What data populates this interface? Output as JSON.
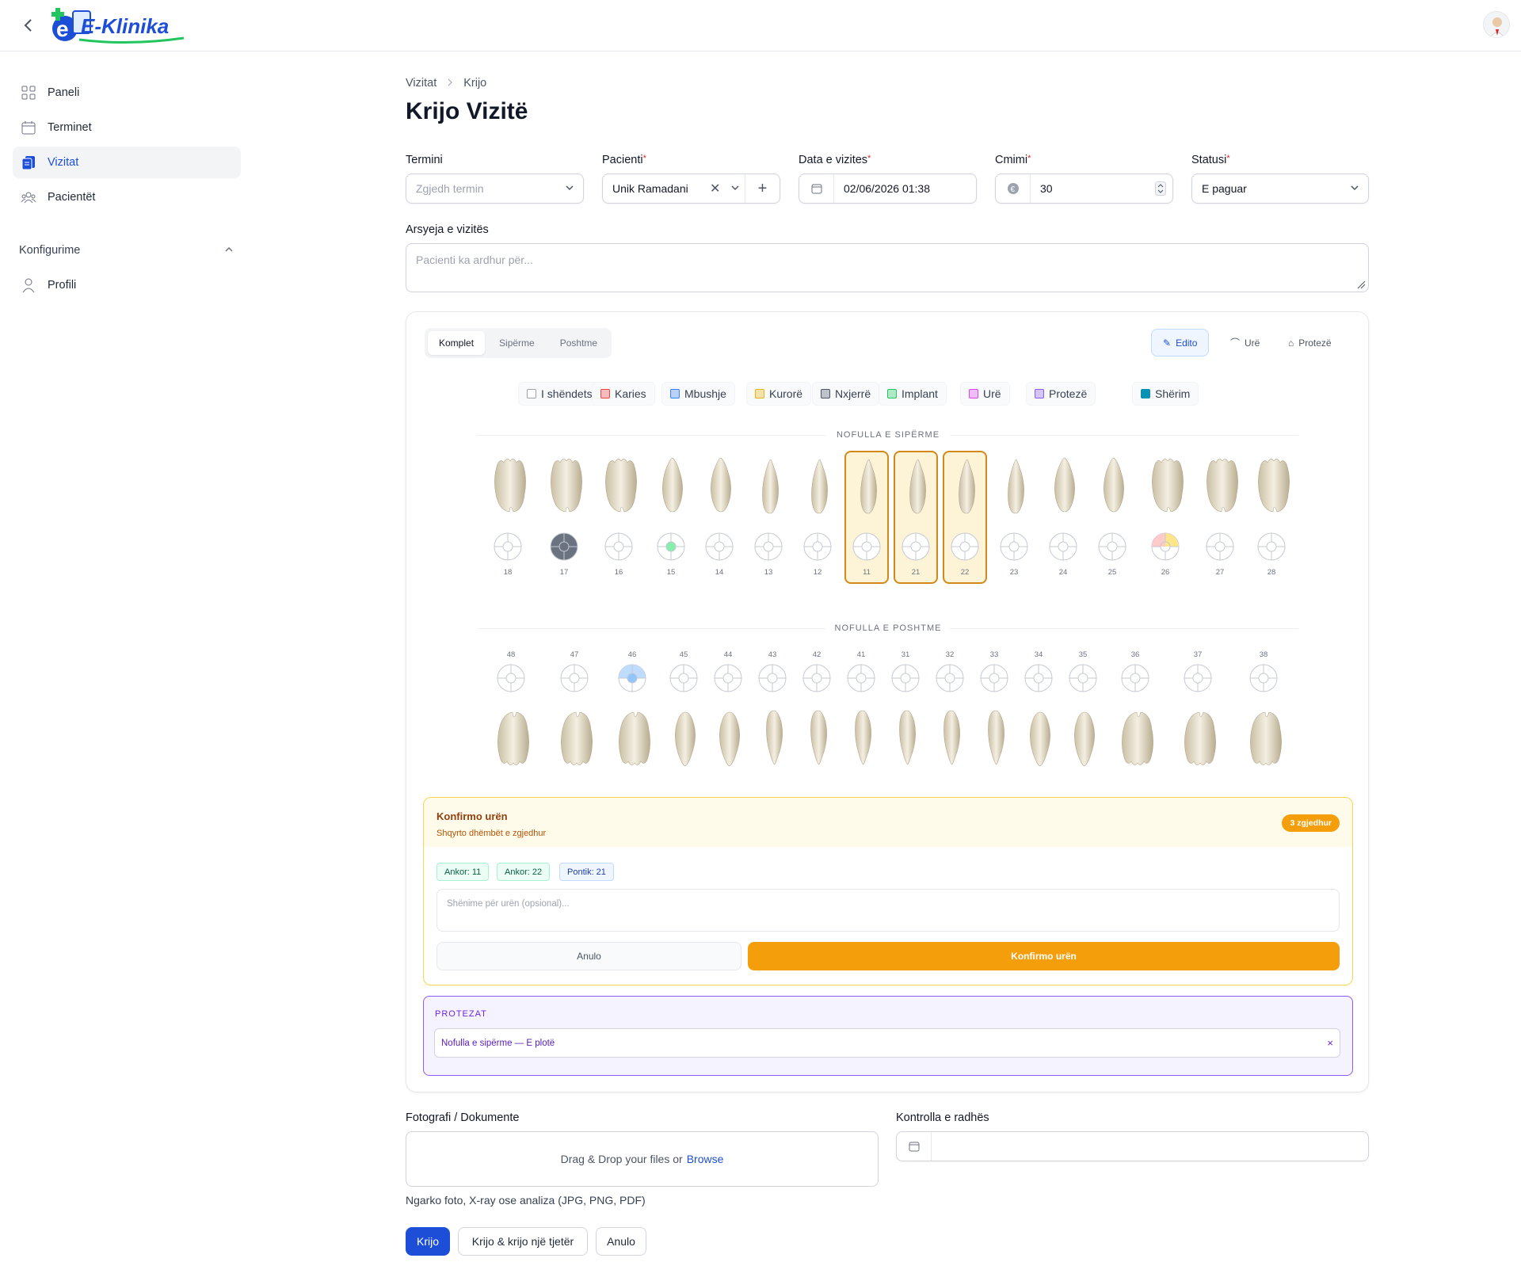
{
  "app": {
    "name": "E-Klinika"
  },
  "sidebar": {
    "items": [
      {
        "label": "Paneli"
      },
      {
        "label": "Terminet"
      },
      {
        "label": "Vizitat"
      },
      {
        "label": "Pacientët"
      }
    ],
    "group": "Konfigurime",
    "sub_items": [
      {
        "label": "Profili"
      }
    ]
  },
  "breadcrumb": {
    "parent": "Vizitat",
    "current": "Krijo"
  },
  "page": {
    "title": "Krijo Vizitë"
  },
  "form": {
    "termini": {
      "label": "Termini",
      "placeholder": "Zgjedh termin"
    },
    "pacienti": {
      "label": "Pacienti",
      "value": "Unik Ramadani"
    },
    "data": {
      "label": "Data e vizites",
      "value": "02/06/2026 01:38"
    },
    "cmimi": {
      "label": "Cmimi",
      "value": "30"
    },
    "statusi": {
      "label": "Statusi",
      "value": "E paguar"
    },
    "arsyeja": {
      "label": "Arsyeja e vizitës",
      "placeholder": "Pacienti ka ardhur për..."
    }
  },
  "chart": {
    "tabs": [
      "Komplet",
      "Sipërme",
      "Poshtme"
    ],
    "tools": [
      "Edito",
      "Urë",
      "Protezë"
    ],
    "legend": [
      {
        "label": "I shëndetshëm",
        "color": "#9ca3af"
      },
      {
        "label": "Karies",
        "color": "#ef4444"
      },
      {
        "label": "Mbushje",
        "color": "#3b82f6"
      },
      {
        "label": "Kurorë",
        "color": "#eab308"
      },
      {
        "label": "Nxjerrë",
        "color": "#4b5563"
      },
      {
        "label": "Implant",
        "color": "#22c55e"
      },
      {
        "label": "Urë",
        "color": "#d946ef"
      },
      {
        "label": "Protezë",
        "color": "#8b5cf6"
      },
      {
        "label": "Shërim",
        "color": "#0891b2"
      }
    ],
    "upper_title": "NOFULLA E SIPËRME",
    "lower_title": "NOFULLA E POSHTME",
    "upper": [
      "18",
      "17",
      "16",
      "15",
      "14",
      "13",
      "12",
      "11",
      "21",
      "22",
      "23",
      "24",
      "25",
      "26",
      "27",
      "28"
    ],
    "lower": [
      "48",
      "47",
      "46",
      "45",
      "44",
      "43",
      "42",
      "41",
      "31",
      "32",
      "33",
      "34",
      "35",
      "36",
      "37",
      "38"
    ]
  },
  "confirm": {
    "title": "Konfirmo urën",
    "subtitle": "Shqyrto dhëmbët e zgjedhur",
    "badge": "3 zgjedhur",
    "chips": [
      "Ankor: 11",
      "Ankor: 22",
      "Pontik: 21"
    ],
    "notes_placeholder": "Shënime për urën (opsional)...",
    "cancel": "Anulo",
    "confirm": "Konfirmo urën"
  },
  "protezat": {
    "title": "PROTEZAT",
    "item": "Nofulla e sipërme — E plotë",
    "remove": "×"
  },
  "uploads": {
    "label": "Fotografi / Dokumente",
    "drop_text": "Drag & Drop your files or",
    "browse": "Browse",
    "hint": "Ngarko foto, X-ray ose analiza (JPG, PNG, PDF)"
  },
  "kontrolla": {
    "label": "Kontrolla e radhës"
  },
  "actions": {
    "create": "Krijo",
    "create_another": "Krijo & krijo një tjetër",
    "cancel": "Anulo"
  }
}
